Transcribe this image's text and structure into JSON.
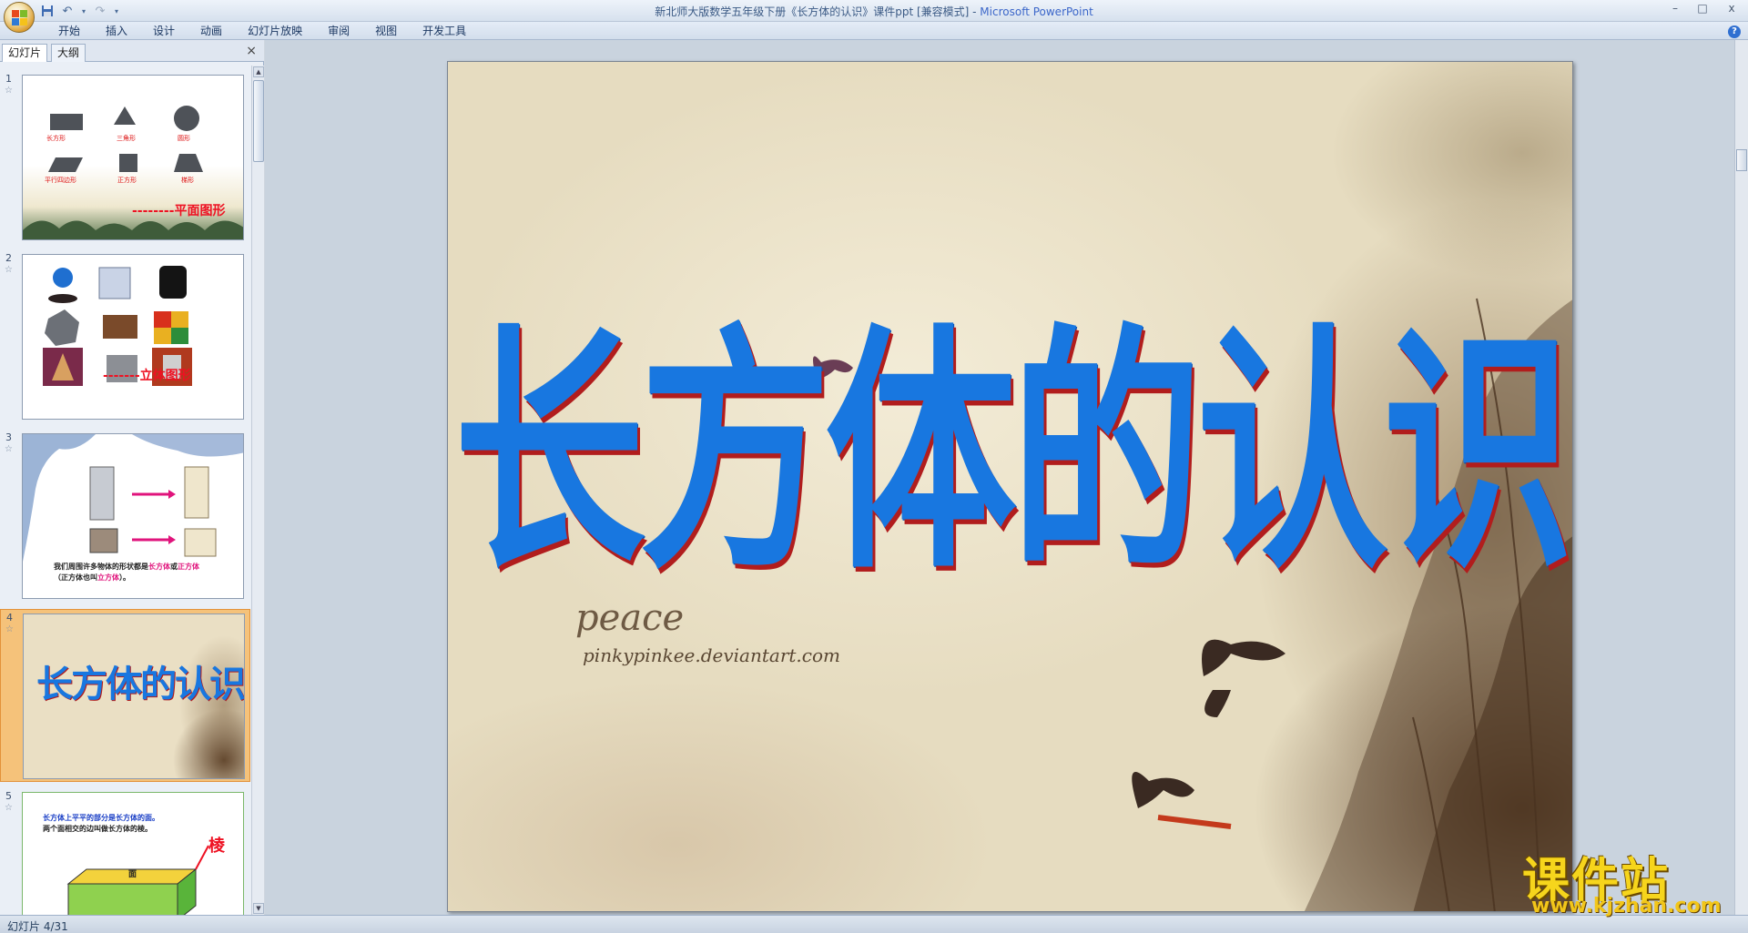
{
  "window": {
    "title_doc": "新北师大版数学五年级下册《长方体的认识》课件ppt [兼容模式]",
    "title_sep": " - ",
    "title_app": "Microsoft PowerPoint",
    "minimize": "–",
    "maximize": "□",
    "close": "x"
  },
  "quick_access": {
    "save_icon": "save-icon",
    "undo_icon": "undo-icon",
    "redo_icon": "redo-icon",
    "more": "▾"
  },
  "ribbon": {
    "tabs": [
      {
        "label": "开始"
      },
      {
        "label": "插入"
      },
      {
        "label": "设计"
      },
      {
        "label": "动画"
      },
      {
        "label": "幻灯片放映"
      },
      {
        "label": "审阅"
      },
      {
        "label": "视图"
      },
      {
        "label": "开发工具"
      }
    ],
    "help": "?"
  },
  "left_pane": {
    "tabs": [
      {
        "label": "幻灯片"
      },
      {
        "label": "大纲"
      }
    ],
    "close": "×",
    "thumbnails": [
      {
        "num": "1",
        "star": "☆",
        "shape_labels": [
          "长方形",
          "三角形",
          "圆形",
          "平行四边形",
          "正方形",
          "梯形"
        ],
        "caption": "--------平面图形"
      },
      {
        "num": "2",
        "star": "☆",
        "caption": "-------立体图形"
      },
      {
        "num": "3",
        "star": "☆",
        "line1_a": "我们周围许多物体的形状都是",
        "line1_b": "长方体",
        "line1_c": "或",
        "line1_d": "正方体",
        "line2_a": "（正方体也叫",
        "line2_b": "立方体",
        "line2_c": "）。"
      },
      {
        "num": "4",
        "star": "☆",
        "title": "长方体的认识"
      },
      {
        "num": "5",
        "star": "☆",
        "line1": "长方体上平平的部分是长方体的面。",
        "line2": "两个面相交的边叫做长方体的棱。",
        "tag": "棱",
        "face": "面"
      }
    ]
  },
  "slide": {
    "title": "长方体的认识",
    "peace": "peace",
    "url": "pinkypinkee.deviantart.com"
  },
  "status": {
    "slide_count": "幻灯片 4/31"
  },
  "watermark": {
    "title": "课件站",
    "url": "www.kjzhan.com"
  },
  "colors": {
    "title_blue": "#1877e0",
    "title_shadow": "#b11d1d",
    "active_thumb": "#f5c27a"
  }
}
